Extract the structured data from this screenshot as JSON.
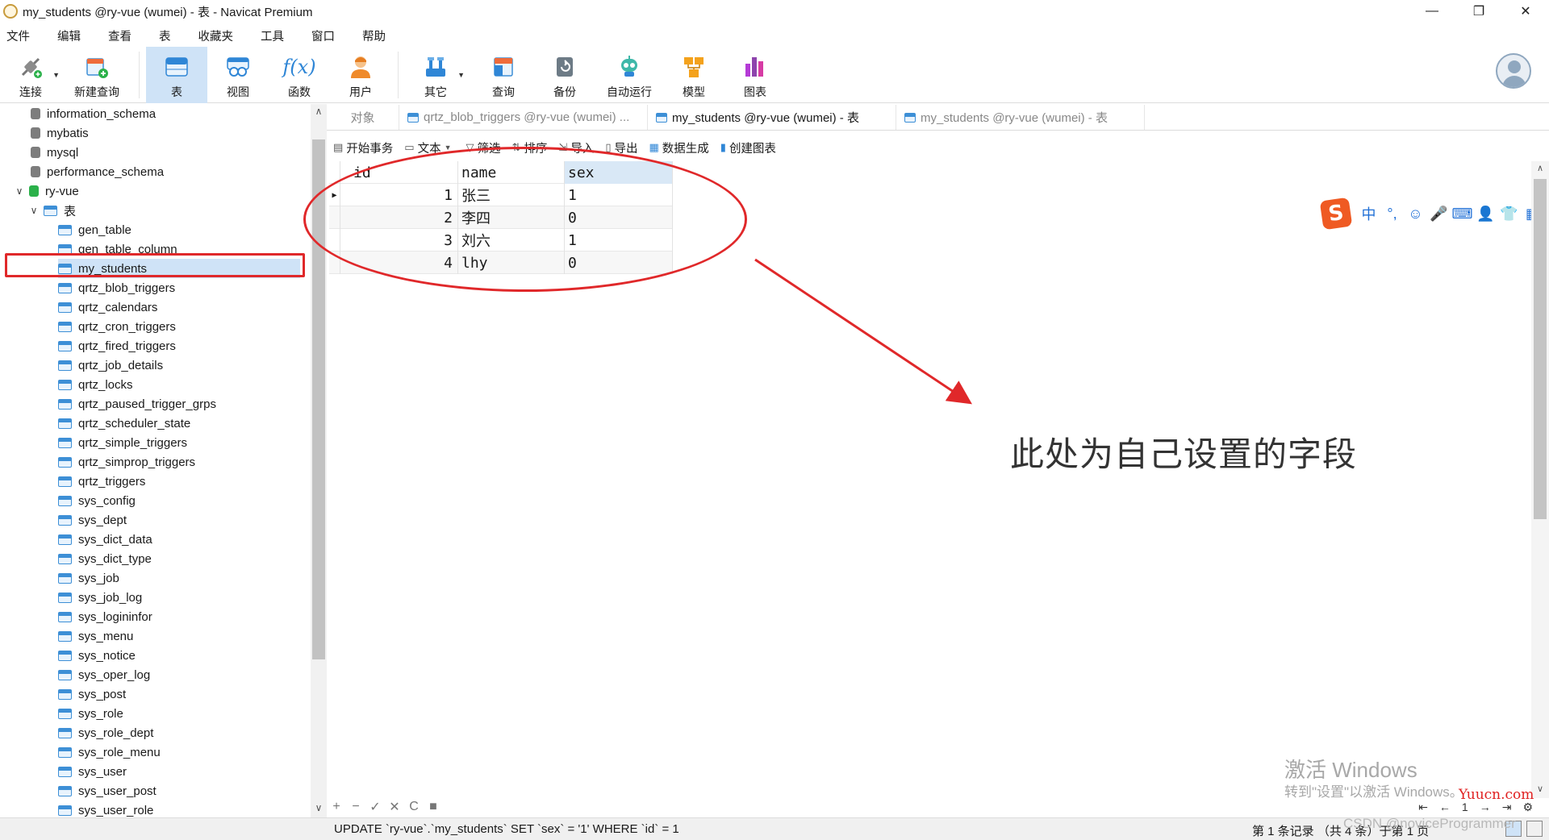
{
  "window": {
    "title": "my_students @ry-vue (wumei) - 表 - Navicat Premium",
    "controls": [
      "—",
      "❐",
      "✕"
    ]
  },
  "menu": [
    "文件",
    "编辑",
    "查看",
    "表",
    "收藏夹",
    "工具",
    "窗口",
    "帮助"
  ],
  "toolbar": [
    {
      "label": "连接",
      "icon": "connect-icon",
      "caret": true
    },
    {
      "label": "新建查询",
      "icon": "new-query-icon"
    },
    {
      "label": "表",
      "icon": "table-icon",
      "active": true
    },
    {
      "label": "视图",
      "icon": "view-icon"
    },
    {
      "label": "函数",
      "icon": "function-icon",
      "glyph": "f(x)"
    },
    {
      "label": "用户",
      "icon": "user-icon"
    },
    {
      "label": "其它",
      "icon": "other-icon",
      "caret": true
    },
    {
      "label": "查询",
      "icon": "query-icon"
    },
    {
      "label": "备份",
      "icon": "backup-icon"
    },
    {
      "label": "自动运行",
      "icon": "automation-icon"
    },
    {
      "label": "模型",
      "icon": "model-icon"
    },
    {
      "label": "图表",
      "icon": "chart-icon"
    }
  ],
  "sidebar": {
    "databases_before": [
      "information_schema",
      "mybatis",
      "mysql",
      "performance_schema"
    ],
    "open_db": "ry-vue",
    "tables_node": "表",
    "tables": [
      "gen_table",
      "gen_table_column",
      "my_students",
      "qrtz_blob_triggers",
      "qrtz_calendars",
      "qrtz_cron_triggers",
      "qrtz_fired_triggers",
      "qrtz_job_details",
      "qrtz_locks",
      "qrtz_paused_trigger_grps",
      "qrtz_scheduler_state",
      "qrtz_simple_triggers",
      "qrtz_simprop_triggers",
      "qrtz_triggers",
      "sys_config",
      "sys_dept",
      "sys_dict_data",
      "sys_dict_type",
      "sys_job",
      "sys_job_log",
      "sys_logininfor",
      "sys_menu",
      "sys_notice",
      "sys_oper_log",
      "sys_post",
      "sys_role",
      "sys_role_dept",
      "sys_role_menu",
      "sys_user",
      "sys_user_post",
      "sys_user_role"
    ],
    "selected_table": "my_students"
  },
  "tabs": [
    {
      "label": "对象",
      "kind": "objects"
    },
    {
      "label": "qrtz_blob_triggers @ry-vue (wumei) ...",
      "kind": "table"
    },
    {
      "label": "my_students @ry-vue (wumei) - 表",
      "kind": "table",
      "active": true
    },
    {
      "label": "my_students @ry-vue (wumei) - 表",
      "kind": "design"
    }
  ],
  "editor_toolbar": [
    {
      "label": "开始事务",
      "icon": "transaction-icon"
    },
    {
      "label": "文本",
      "icon": "text-icon",
      "caret": true
    },
    {
      "label": "筛选",
      "icon": "filter-icon"
    },
    {
      "label": "排序",
      "icon": "sort-icon"
    },
    {
      "label": "导入",
      "icon": "import-icon"
    },
    {
      "label": "导出",
      "icon": "export-icon"
    },
    {
      "label": "数据生成",
      "icon": "data-gen-icon"
    },
    {
      "label": "创建图表",
      "icon": "create-chart-icon"
    }
  ],
  "grid": {
    "columns": [
      "id",
      "name",
      "sex"
    ],
    "rows": [
      {
        "id": "1",
        "name": "张三",
        "sex": "1"
      },
      {
        "id": "2",
        "name": "李四",
        "sex": "0"
      },
      {
        "id": "3",
        "name": "刘六",
        "sex": "1"
      },
      {
        "id": "4",
        "name": "lhy",
        "sex": "0"
      }
    ]
  },
  "annotation": "此处为自己设置的字段",
  "ime": [
    "中",
    "°,",
    "☺",
    "🎤",
    "⌨",
    "👤",
    "👕",
    "▦"
  ],
  "bottom_buttons": [
    "+",
    "−",
    "✓",
    "✕",
    "C",
    "■"
  ],
  "pager": {
    "first": "⇤",
    "prev": "←",
    "page": "1",
    "next": "→",
    "last": "⇥",
    "settings": "⚙"
  },
  "watermark": {
    "title": "激活 Windows",
    "subtitle": "转到\"设置\"以激活 Windows。"
  },
  "site_mark": "Yuucn.com",
  "csdn_mark": "CSDN @noviceProgrammer",
  "status": {
    "sql": "UPDATE `ry-vue`.`my_students` SET `sex` = '1' WHERE `id` = 1",
    "records": "第 1 条记录 （共 4 条）于第 1 页"
  },
  "colors": {
    "accent": "#cfe3f7",
    "highlight": "#e0282a"
  }
}
